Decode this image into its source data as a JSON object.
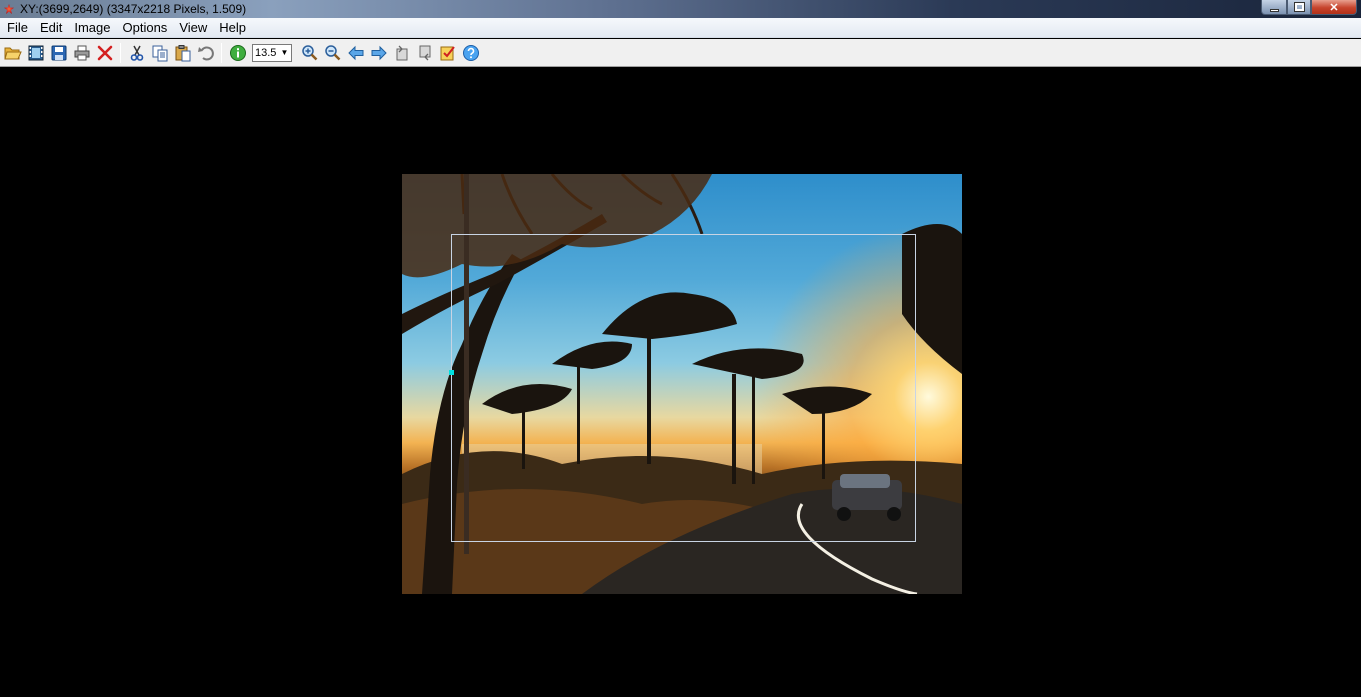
{
  "window": {
    "title": "XY:(3699,2649) (3347x2218 Pixels, 1.509)",
    "buttons": {
      "minimize": "",
      "maximize": "",
      "close": "✕"
    }
  },
  "menu": {
    "items": [
      "File",
      "Edit",
      "Image",
      "Options",
      "View",
      "Help"
    ]
  },
  "toolbar": {
    "zoom_value": "13.5",
    "zoom_arrow": "▼",
    "icons": [
      "open-folder-icon",
      "filmstrip-icon",
      "save-icon",
      "print-icon",
      "delete-icon",
      "cut-icon",
      "copy-icon",
      "paste-icon",
      "undo-icon",
      "info-icon",
      "zoom-in-icon",
      "zoom-out-icon",
      "previous-arrow-icon",
      "next-arrow-icon",
      "rotate-left-icon",
      "rotate-right-icon",
      "checklist-icon",
      "help-icon"
    ]
  },
  "colors": {
    "canvas_background": "#000000",
    "selection_border": "#c8d4e4",
    "selection_handle": "#00e0e0",
    "toolbar_background": "#f0f0f0"
  }
}
